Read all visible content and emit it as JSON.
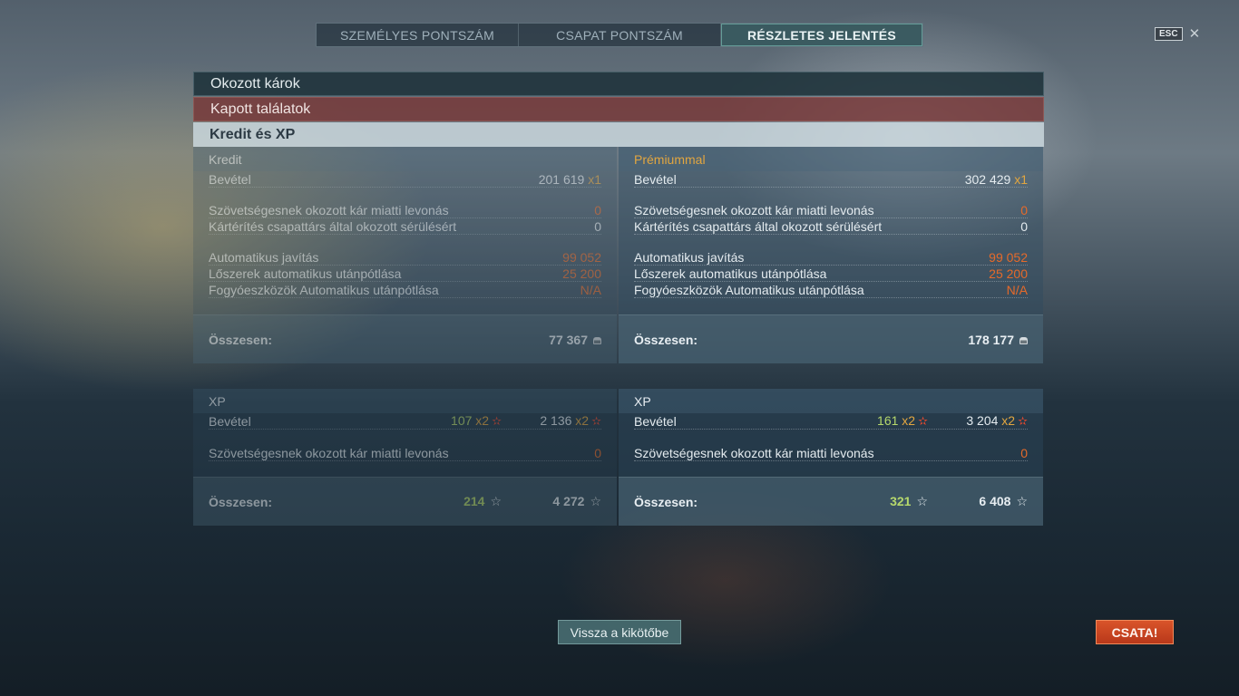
{
  "tabs": [
    {
      "label": "SZEMÉLYES PONTSZÁM"
    },
    {
      "label": "CSAPAT PONTSZÁM"
    },
    {
      "label": "RÉSZLETES JELENTÉS"
    }
  ],
  "esc": {
    "key_label": "ESC",
    "close_glyph": "✕"
  },
  "sections": {
    "damage": "Okozott károk",
    "hits": "Kapott találatok",
    "credit_xp": "Kredit és XP"
  },
  "credit": {
    "standard": {
      "title": "Kredit",
      "income_label": "Bevétel",
      "income_value": "201 619",
      "income_mult": "x1",
      "ally_damage_label": "Szövetségesnek okozott kár miatti levonás",
      "ally_damage_value": "0",
      "compensation_label": "Kártérítés csapattárs által okozott sérülésért",
      "compensation_value": "0",
      "repair_label": "Automatikus javítás",
      "repair_value": "99 052",
      "ammo_label": "Lőszerek automatikus utánpótlása",
      "ammo_value": "25 200",
      "consumables_label": "Fogyóeszközök Automatikus utánpótlása",
      "consumables_value": "N/A",
      "total_label": "Összesen:",
      "total_value": "77 367"
    },
    "premium": {
      "title": "Prémiummal",
      "income_label": "Bevétel",
      "income_value": "302 429",
      "income_mult": "x1",
      "ally_damage_label": "Szövetségesnek okozott kár miatti levonás",
      "ally_damage_value": "0",
      "compensation_label": "Kártérítés csapattárs által okozott sérülésért",
      "compensation_value": "0",
      "repair_label": "Automatikus javítás",
      "repair_value": "99 052",
      "ammo_label": "Lőszerek automatikus utánpótlása",
      "ammo_value": "25 200",
      "consumables_label": "Fogyóeszközök Automatikus utánpótlása",
      "consumables_value": "N/A",
      "total_label": "Összesen:",
      "total_value": "178 177"
    }
  },
  "xp": {
    "standard": {
      "title": "XP",
      "income_label": "Bevétel",
      "income_value_1": "107",
      "income_mult_1": "x2",
      "income_value_2": "2 136",
      "income_mult_2": "x2",
      "ally_damage_label": "Szövetségesnek okozott kár miatti levonás",
      "ally_damage_value": "0",
      "total_label": "Összesen:",
      "total_value_1": "214",
      "total_value_2": "4 272"
    },
    "premium": {
      "title": "XP",
      "income_label": "Bevétel",
      "income_value_1": "161",
      "income_mult_1": "x2",
      "income_value_2": "3 204",
      "income_mult_2": "x2",
      "ally_damage_label": "Szövetségesnek okozott kár miatti levonás",
      "ally_damage_value": "0",
      "total_label": "Összesen:",
      "total_value_1": "321",
      "total_value_2": "6 408"
    }
  },
  "buttons": {
    "back": "Vissza a kikötőbe",
    "battle": "CSATA!"
  },
  "icons": {
    "credit": "credit-coin-icon",
    "xp_star": "xp-star-icon",
    "multiplier_star": "multiplier-star-icon",
    "close": "close-icon"
  },
  "colors": {
    "accent_orange": "#e56a2a",
    "premium_gold": "#e2a640",
    "xp_green": "#b6d86c",
    "battle_red": "#c9441f"
  }
}
